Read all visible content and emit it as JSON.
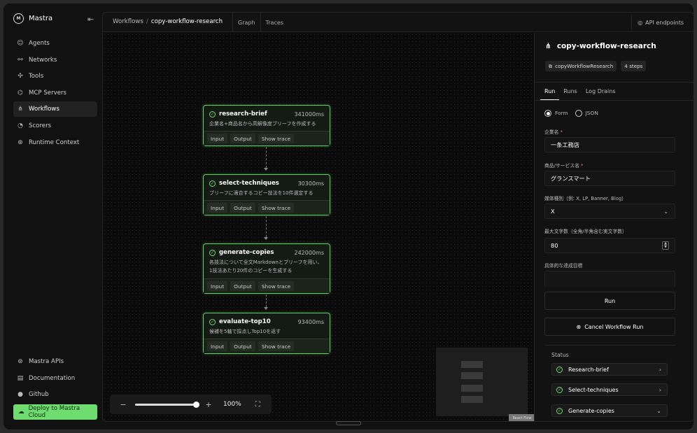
{
  "app": {
    "name": "Mastra"
  },
  "sidebar": {
    "items": [
      {
        "label": "Agents",
        "icon": "agents-icon"
      },
      {
        "label": "Networks",
        "icon": "networks-icon"
      },
      {
        "label": "Tools",
        "icon": "tools-icon"
      },
      {
        "label": "MCP Servers",
        "icon": "mcp-icon"
      },
      {
        "label": "Workflows",
        "icon": "workflows-icon",
        "active": true
      },
      {
        "label": "Scorers",
        "icon": "scorers-icon"
      },
      {
        "label": "Runtime Context",
        "icon": "globe-icon"
      }
    ],
    "bottom": [
      {
        "label": "Mastra APIs"
      },
      {
        "label": "Documentation"
      },
      {
        "label": "Github"
      }
    ],
    "deploy_label": "Deploy to Mastra Cloud"
  },
  "header": {
    "crumb_root": "Workflows",
    "crumb_current": "copy-workflow-research",
    "tabs": [
      "Graph",
      "Traces"
    ],
    "api_label": "API endpoints"
  },
  "nodes": [
    {
      "title": "research-brief",
      "time": "341000ms",
      "desc": "企業名+商品名から高解像度ブリーフを作成する",
      "chips": [
        "Input",
        "Output",
        "Show trace"
      ]
    },
    {
      "title": "select-techniques",
      "time": "30300ms",
      "desc": "ブリーフに適合するコピー技法を10件選定する",
      "chips": [
        "Input",
        "Output",
        "Show trace"
      ]
    },
    {
      "title": "generate-copies",
      "time": "242000ms",
      "desc": "各技法について全文Markdownとブリーフを用い、1技法あたり20件のコピーを生成する",
      "chips": [
        "Input",
        "Output",
        "Show trace"
      ]
    },
    {
      "title": "evaluate-top10",
      "time": "93400ms",
      "desc": "候補を5軸で採点しTop10を返す",
      "chips": [
        "Input",
        "Output",
        "Show trace"
      ]
    }
  ],
  "zoom": {
    "value": "100%"
  },
  "panel": {
    "title": "copy-workflow-research",
    "id": "copyWorkflowResearch",
    "steps_badge": "4 steps",
    "tabs": [
      "Run",
      "Runs",
      "Log Drains"
    ],
    "radio_form": "Form",
    "radio_json": "JSON",
    "fields": {
      "company_label": "企業名",
      "company_value": "一条工務店",
      "product_label": "商品/サービス名",
      "product_value": "グランスマート",
      "media_label": "媒体種別（例: X, LP, Banner, Blog）",
      "media_value": "X",
      "maxlen_label": "最大文字数（全角/半角含む実文字数）",
      "maxlen_value": "80",
      "goal_label": "具体的な達成目標",
      "goal_value": ""
    },
    "run_label": "Run",
    "cancel_label": "Cancel Workflow Run",
    "status_label": "Status",
    "status_items": [
      "Research-brief",
      "Select-techniques",
      "Generate-copies"
    ],
    "minimap_label": "React Flow"
  },
  "colors": {
    "accent": "#6fdc6f",
    "node_border": "#5fcf5f"
  }
}
